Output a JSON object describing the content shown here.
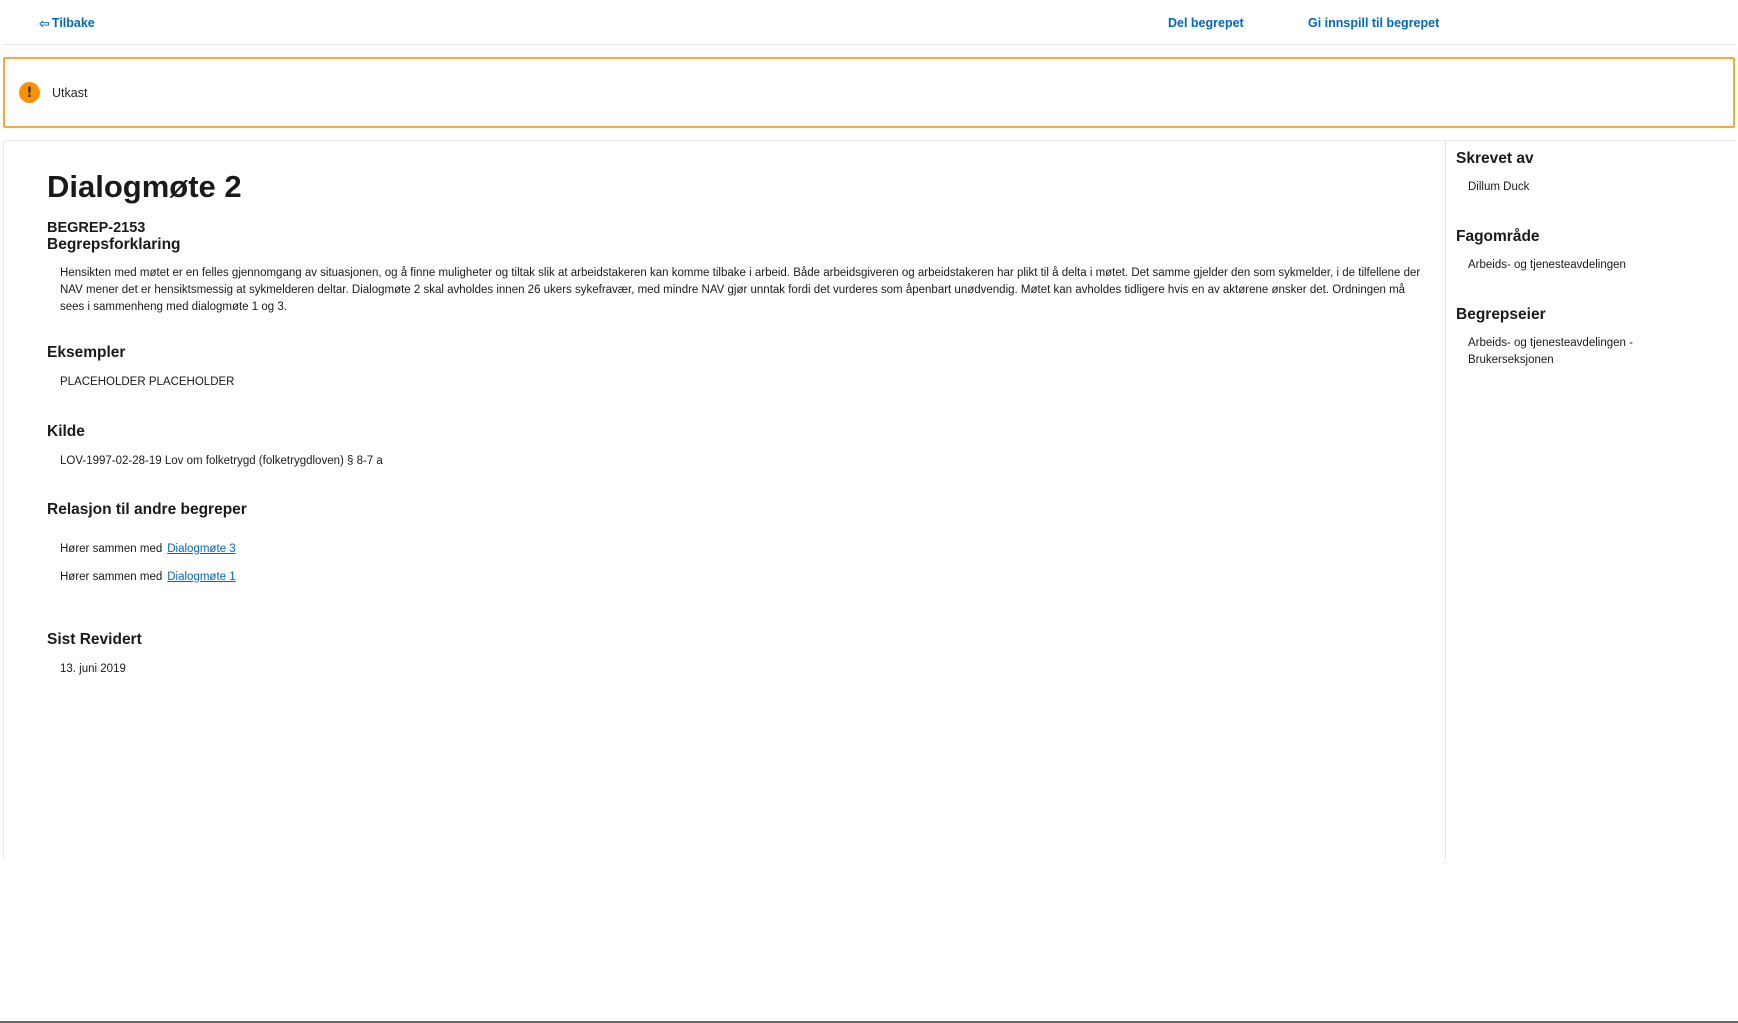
{
  "topbar": {
    "back_label": "Tilbake",
    "share_label": "Del begrepet",
    "feedback_label": "Gi innspill til begrepet"
  },
  "banner": {
    "status": "Utkast",
    "icon": "exclamation-circle-icon",
    "accent_color": "#ffa733"
  },
  "concept": {
    "title": "Dialogmøte 2",
    "id": "BEGREP-2153",
    "explanation_heading": "Begrepsforklaring",
    "explanation": "Hensikten med møtet er en felles gjennomgang av situasjonen, og å finne muligheter og tiltak slik at arbeidstakeren kan komme tilbake i arbeid. Både arbeidsgiveren og arbeidstakeren har plikt til å delta i møtet. Det samme gjelder den som sykmelder, i de tilfellene der NAV mener det er hensiktsmessig at sykmelderen deltar. Dialogmøte 2 skal avholdes innen 26 ukers sykefravær, med mindre NAV gjør unntak fordi det vurderes som åpenbart unødvendig. Møtet kan avholdes tidligere hvis en av aktørene ønsker det. Ordningen må sees i sammenheng med dialogmøte 1 og 3.",
    "examples_heading": "Eksempler",
    "examples": "PLACEHOLDER PLACEHOLDER",
    "source_heading": "Kilde",
    "source": "LOV-1997-02-28-19 Lov om folketrygd (folketrygdloven) § 8-7 a",
    "relations_heading": "Relasjon til andre begreper",
    "relations": [
      {
        "label": "Hører sammen med",
        "link": "Dialogmøte 3"
      },
      {
        "label": "Hører sammen med",
        "link": "Dialogmøte 1"
      }
    ],
    "revised_heading": "Sist Revidert",
    "revised": "13. juni 2019"
  },
  "sidebar": {
    "author_heading": "Skrevet av",
    "author": "Dillum Duck",
    "domain_heading": "Fagområde",
    "domain": "Arbeids- og tjenesteavdelingen",
    "owner_heading": "Begrepseier",
    "owner": "Arbeids- og tjenesteavdelingen - Brukerseksjonen"
  }
}
